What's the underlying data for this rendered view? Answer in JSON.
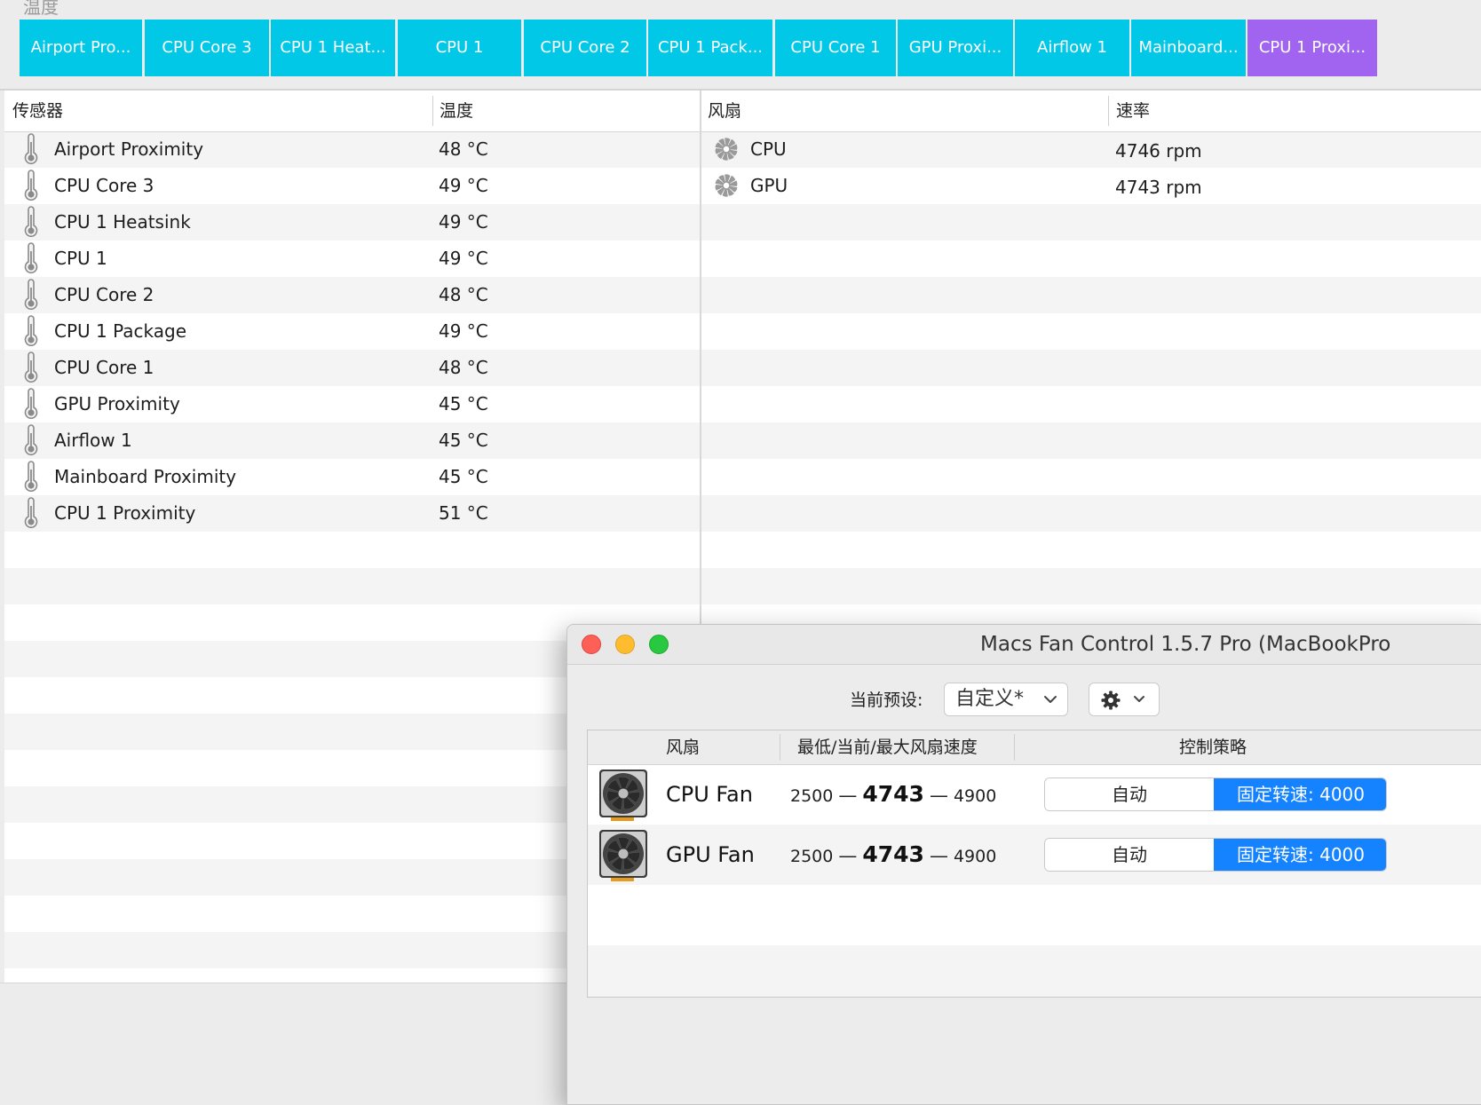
{
  "header": {
    "section_title": "温度"
  },
  "tabs": [
    {
      "label": "Airport Pro...",
      "active": false
    },
    {
      "label": "CPU Core 3",
      "active": false
    },
    {
      "label": "CPU 1 Heat...",
      "active": false
    },
    {
      "label": "CPU 1",
      "active": false
    },
    {
      "label": "CPU Core 2",
      "active": false
    },
    {
      "label": "CPU 1 Pack...",
      "active": false
    },
    {
      "label": "CPU Core 1",
      "active": false
    },
    {
      "label": "GPU Proxi...",
      "active": false
    },
    {
      "label": "Airflow 1",
      "active": false
    },
    {
      "label": "Mainboard...",
      "active": false
    },
    {
      "label": "CPU 1 Proxi...",
      "active": true
    }
  ],
  "sensors_table": {
    "headers": {
      "sensor": "传感器",
      "temperature": "温度"
    },
    "rows": [
      {
        "name": "Airport Proximity",
        "temp": "48 °C"
      },
      {
        "name": "CPU Core 3",
        "temp": "49 °C"
      },
      {
        "name": "CPU 1 Heatsink",
        "temp": "49 °C"
      },
      {
        "name": "CPU 1",
        "temp": "49 °C"
      },
      {
        "name": "CPU Core 2",
        "temp": "48 °C"
      },
      {
        "name": "CPU 1 Package",
        "temp": "49 °C"
      },
      {
        "name": "CPU Core 1",
        "temp": "48 °C"
      },
      {
        "name": "GPU Proximity",
        "temp": "45 °C"
      },
      {
        "name": "Airflow 1",
        "temp": "45 °C"
      },
      {
        "name": "Mainboard Proximity",
        "temp": "45 °C"
      },
      {
        "name": "CPU 1 Proximity",
        "temp": "51 °C"
      }
    ]
  },
  "fans_table": {
    "headers": {
      "fan": "风扇",
      "speed": "速率"
    },
    "rows": [
      {
        "name": "CPU",
        "rpm": "4746 rpm"
      },
      {
        "name": "GPU",
        "rpm": "4743 rpm"
      }
    ]
  },
  "window": {
    "title": "Macs Fan Control 1.5.7 Pro (MacBookPro",
    "preset_label": "当前预设:",
    "preset_value": "自定义*",
    "table_headers": {
      "fan": "风扇",
      "speeds": "最低/当前/最大风扇速度",
      "control": "控制策略"
    },
    "fans": [
      {
        "name": "CPU Fan",
        "min": "2500",
        "current": "4743",
        "max": "4900",
        "auto_label": "自动",
        "fixed_label": "固定转速: 4000"
      },
      {
        "name": "GPU Fan",
        "min": "2500",
        "current": "4743",
        "max": "4900",
        "auto_label": "自动",
        "fixed_label": "固定转速: 4000"
      }
    ]
  },
  "colors": {
    "tab": "#00c8e6",
    "tab_active": "#a064f0",
    "accent_blue": "#1583ff",
    "close": "#fe5f57",
    "minimize": "#febc2e",
    "maximize": "#28c840"
  },
  "icons": {
    "sensor_row": "thermometer-icon",
    "fan_row": "fan-icon",
    "settings": "gear-icon",
    "dropdown": "chevron-down-icon"
  }
}
